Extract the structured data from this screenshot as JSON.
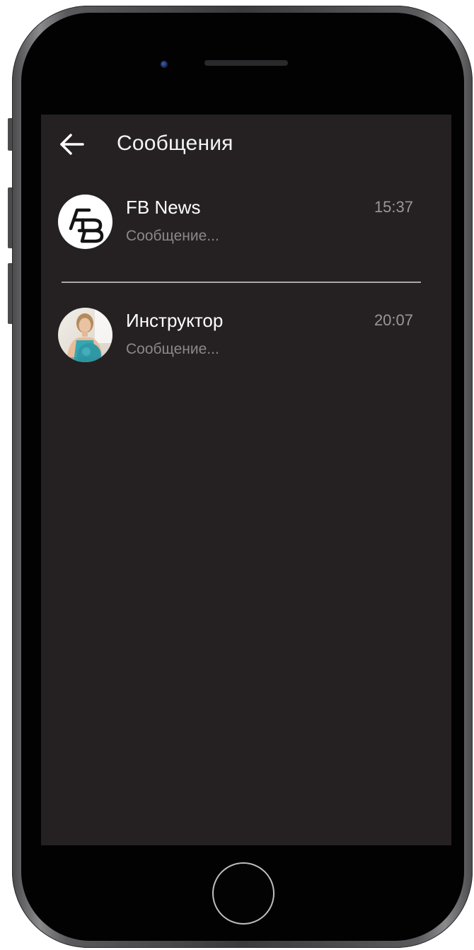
{
  "header": {
    "title": "Сообщения",
    "back_icon": "arrow-left-icon"
  },
  "chats": [
    {
      "name": "FB News",
      "preview": "Сообщение...",
      "time": "15:37",
      "avatar": "fb-logo"
    },
    {
      "name": "Инструктор",
      "preview": "Сообщение...",
      "time": "20:07",
      "avatar": "instructor-photo"
    }
  ],
  "colors": {
    "screen_background": "#252122",
    "primary_text": "#ffffff",
    "secondary_text": "#8b8888",
    "divider": "#a9a7a7"
  }
}
